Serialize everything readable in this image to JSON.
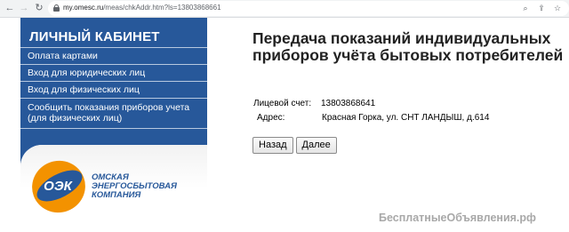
{
  "browser": {
    "url_host": "my.omesc.ru",
    "url_path": "/meas/chkAddr.htm?ls=13803868661",
    "icons": [
      "search-icon",
      "share-icon",
      "star-icon"
    ]
  },
  "sidebar": {
    "title": "ЛИЧНЫЙ КАБИНЕТ",
    "items": [
      {
        "label": "Оплата картами"
      },
      {
        "label": "Вход для юридических лиц"
      },
      {
        "label": "Вход для физических лиц"
      },
      {
        "label_line1": "Сообщить показания приборов учета",
        "label_line2": "(для физических лиц)"
      }
    ],
    "logo": {
      "abbr": "ОЭК",
      "line1": "ОМСКАЯ",
      "line2": "ЭНЕРГОСБЫТОВАЯ",
      "line3": "КОМПАНИЯ"
    }
  },
  "main": {
    "title": "Передача показаний индивидуальных приборов учёта бытовых потребителей",
    "account_label": "Лицевой счет:",
    "account_value": "13803868641",
    "address_label": "Адрес:",
    "address_value": "Красная Горка, ул. СНТ ЛАНДЫШ, д.614",
    "back_button": "Назад",
    "next_button": "Далее"
  },
  "watermark": "БесплатныеОбъявления.рф",
  "colors": {
    "sidebar": "#27589a",
    "logo_orange": "#f39200",
    "logo_blue": "#27589a"
  }
}
